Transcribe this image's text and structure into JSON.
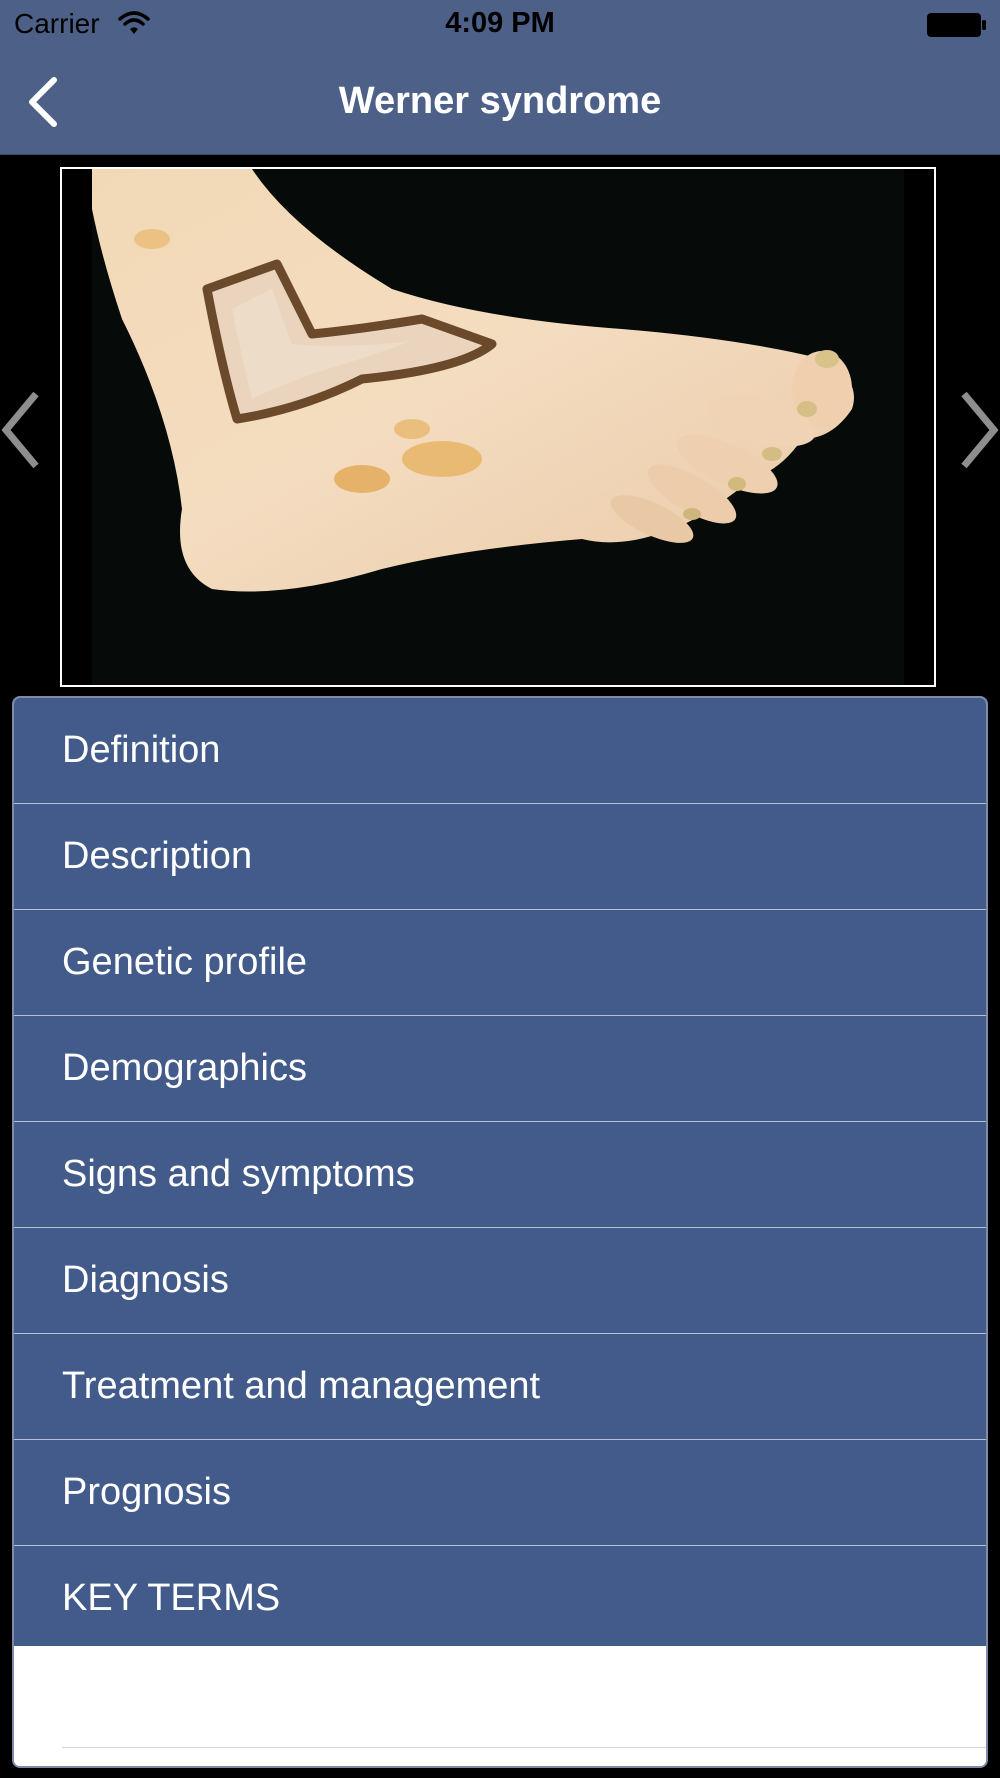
{
  "status_bar": {
    "carrier": "Carrier",
    "time": "4:09 PM",
    "wifi_icon": "wifi-icon",
    "battery_icon": "battery-icon"
  },
  "nav": {
    "title": "Werner syndrome",
    "back_icon": "chevron-left-icon"
  },
  "gallery": {
    "prev_icon": "chevron-left-icon",
    "next_icon": "chevron-right-icon"
  },
  "menu": {
    "items": [
      {
        "label": "Definition"
      },
      {
        "label": "Description"
      },
      {
        "label": "Genetic profile"
      },
      {
        "label": "Demographics"
      },
      {
        "label": "Signs and symptoms"
      },
      {
        "label": "Diagnosis"
      },
      {
        "label": "Treatment and management"
      },
      {
        "label": "Prognosis"
      },
      {
        "label": "KEY TERMS"
      }
    ]
  },
  "colors": {
    "nav_background": "#4d6088",
    "menu_item_background": "#435b8a",
    "text": "#ffffff"
  }
}
